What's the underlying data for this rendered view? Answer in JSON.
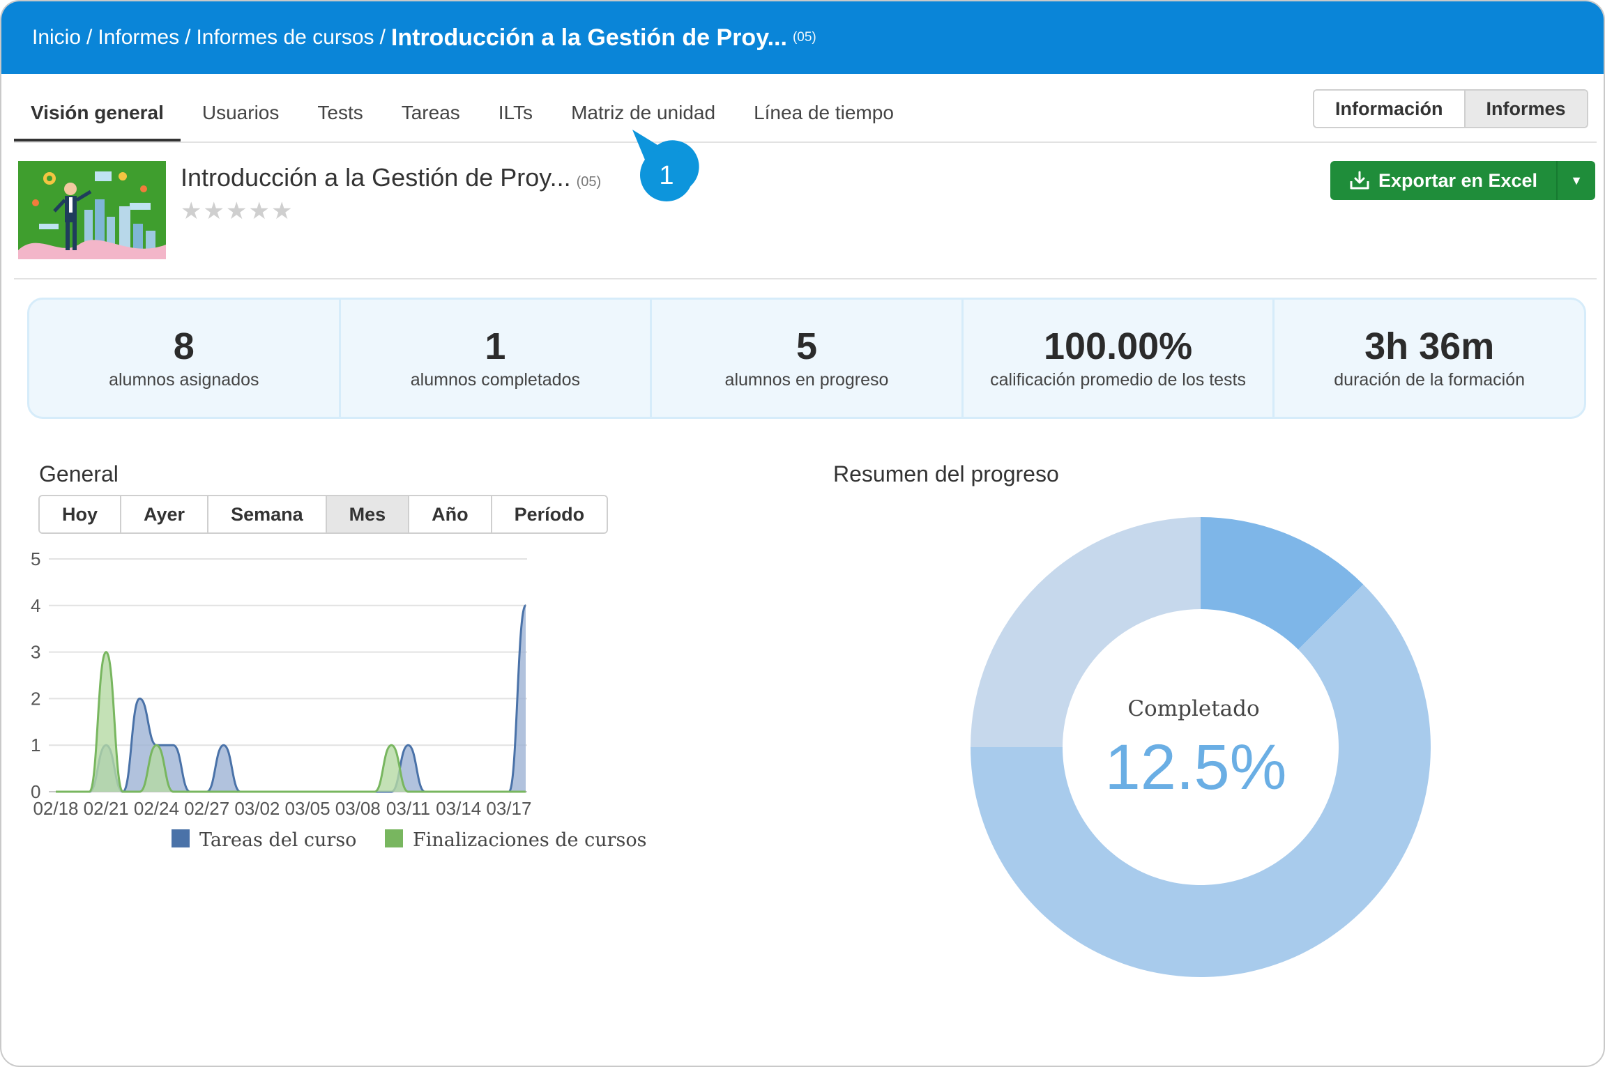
{
  "breadcrumb": {
    "items": [
      "Inicio",
      "Informes",
      "Informes de cursos"
    ],
    "separator": "/",
    "current": "Introducción a la Gestión de Proy...",
    "code": "(05)"
  },
  "tabs": [
    {
      "label": "Visión general",
      "active": true
    },
    {
      "label": "Usuarios",
      "active": false
    },
    {
      "label": "Tests",
      "active": false
    },
    {
      "label": "Tareas",
      "active": false
    },
    {
      "label": "ILTs",
      "active": false
    },
    {
      "label": "Matriz de unidad",
      "active": false
    },
    {
      "label": "Línea de tiempo",
      "active": false
    }
  ],
  "view_toggle": {
    "info_label": "Información",
    "reports_label": "Informes",
    "selected": "Informes"
  },
  "course": {
    "title": "Introducción a la Gestión de Proy...",
    "code": "(05)",
    "rating": 0,
    "max_rating": 5
  },
  "callout": {
    "number": "1"
  },
  "export": {
    "label": "Exportar en Excel"
  },
  "stats": [
    {
      "value": "8",
      "label": "alumnos asignados"
    },
    {
      "value": "1",
      "label": "alumnos completados"
    },
    {
      "value": "5",
      "label": "alumnos en progreso"
    },
    {
      "value": "100.00%",
      "label": "calificación promedio de los tests"
    },
    {
      "value": "3h 36m",
      "label": "duración de la formación"
    }
  ],
  "general": {
    "title": "General",
    "periods": [
      "Hoy",
      "Ayer",
      "Semana",
      "Mes",
      "Año",
      "Período"
    ],
    "selected_period": "Mes"
  },
  "chart_data": [
    {
      "type": "area",
      "x": [
        "02/18",
        "02/19",
        "02/20",
        "02/21",
        "02/22",
        "02/23",
        "02/24",
        "02/25",
        "02/26",
        "02/27",
        "02/28",
        "03/01",
        "03/02",
        "03/03",
        "03/04",
        "03/05",
        "03/06",
        "03/07",
        "03/08",
        "03/09",
        "03/10",
        "03/11",
        "03/12",
        "03/13",
        "03/14",
        "03/15",
        "03/16",
        "03/17",
        "03/18"
      ],
      "x_tick_labels": [
        "02/18",
        "02/21",
        "02/24",
        "02/27",
        "03/02",
        "03/05",
        "03/08",
        "03/11",
        "03/14",
        "03/17"
      ],
      "y_ticks": [
        0,
        1,
        2,
        3,
        4,
        5
      ],
      "ylim": [
        0,
        5
      ],
      "grid": true,
      "legend_position": "bottom",
      "series": [
        {
          "name": "Tareas del curso",
          "color": "#4a72a8",
          "fill": "#9db3d4",
          "values": [
            0,
            0,
            0,
            1,
            0,
            2,
            1,
            1,
            0,
            0,
            1,
            0,
            0,
            0,
            0,
            0,
            0,
            0,
            0,
            0,
            0,
            1,
            0,
            0,
            0,
            0,
            0,
            0,
            4
          ]
        },
        {
          "name": "Finalizaciones de cursos",
          "color": "#78b65f",
          "fill": "#b5d9a4",
          "values": [
            0,
            0,
            0,
            3,
            0,
            0,
            1,
            0,
            0,
            0,
            0,
            0,
            0,
            0,
            0,
            0,
            0,
            0,
            0,
            0,
            1,
            0,
            0,
            0,
            0,
            0,
            0,
            0,
            0
          ]
        }
      ]
    },
    {
      "type": "pie",
      "title": "Resumen del progreso",
      "center_label": "Completado",
      "center_value": "12.5%",
      "slices": [
        {
          "value": 12.5,
          "color": "#7eb6e8"
        },
        {
          "value": 62.5,
          "color": "#a8cbec"
        },
        {
          "value": 25,
          "color": "#c6d8ec"
        }
      ]
    }
  ]
}
